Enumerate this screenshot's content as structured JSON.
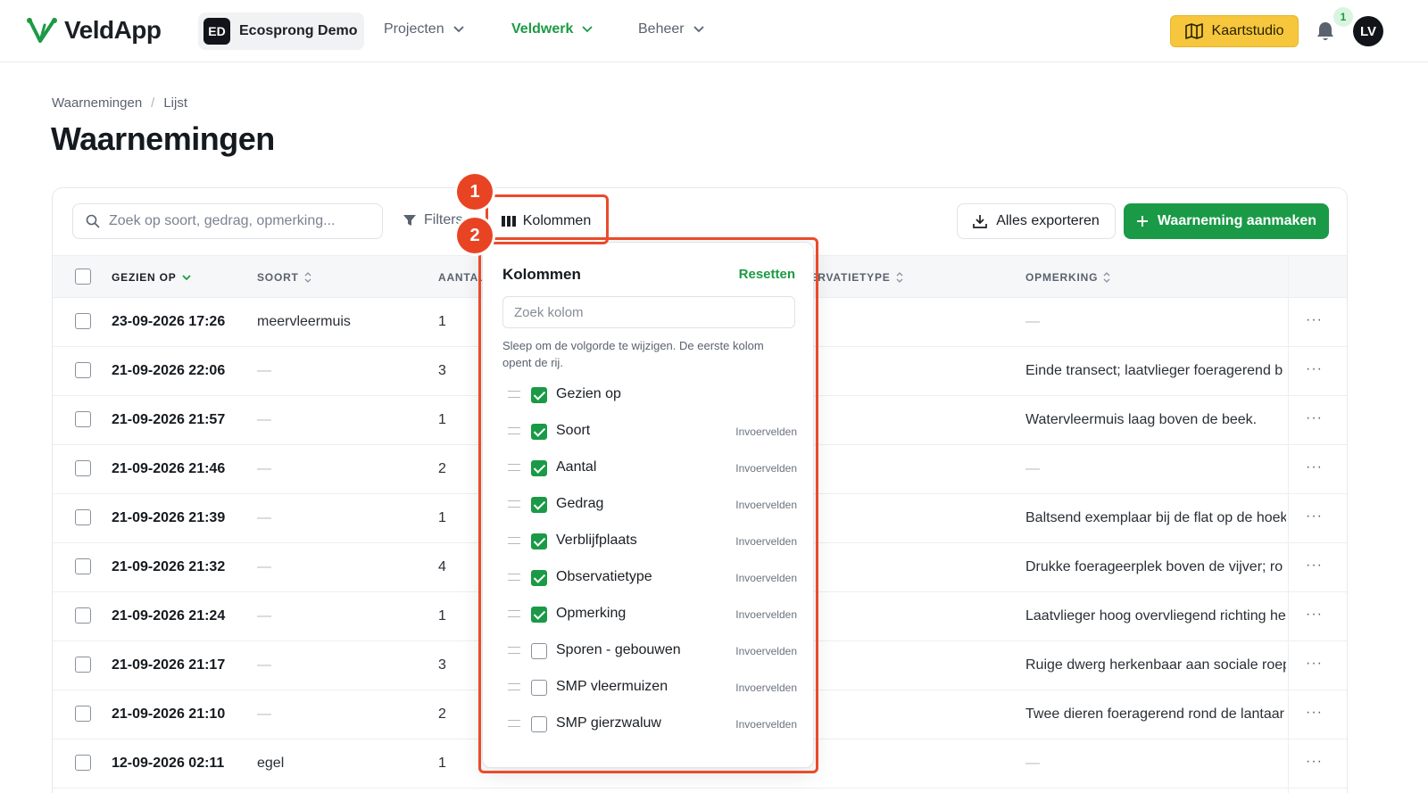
{
  "app": {
    "name": "VeldApp"
  },
  "workspace": {
    "initials": "ED",
    "name": "Ecosprong Demo"
  },
  "nav": [
    {
      "label": "Projecten",
      "active": false
    },
    {
      "label": "Veldwerk",
      "active": true
    },
    {
      "label": "Beheer",
      "active": false
    }
  ],
  "header": {
    "map_button": "Kaartstudio",
    "notifications": "1",
    "avatar": "LV"
  },
  "breadcrumb": [
    "Waarnemingen",
    "Lijst"
  ],
  "page_title": "Waarnemingen",
  "toolbar": {
    "search_placeholder": "Zoek op soort, gedrag, opmerking...",
    "filters": "Filters",
    "columns": "Kolommen",
    "export": "Alles exporteren",
    "create": "Waarneming aanmaken"
  },
  "table": {
    "headers": {
      "date": "GEZIEN OP",
      "species": "SOORT",
      "count": "AANTAL",
      "obstype": "OBSERVATIETYPE",
      "note": "OPMERKING"
    },
    "rows": [
      {
        "date": "23-09-2026 17:26",
        "species": "meervleermuis",
        "count": "1",
        "note": "—"
      },
      {
        "date": "21-09-2026 22:06",
        "species": "—",
        "count": "3",
        "note": "Einde transect; laatvlieger foeragerend b"
      },
      {
        "date": "21-09-2026 21:57",
        "species": "—",
        "count": "1",
        "note": "Watervleermuis laag boven de beek."
      },
      {
        "date": "21-09-2026 21:46",
        "species": "—",
        "count": "2",
        "note": "—"
      },
      {
        "date": "21-09-2026 21:39",
        "species": "—",
        "count": "1",
        "note": "Baltsend exemplaar bij de flat op de hoek"
      },
      {
        "date": "21-09-2026 21:32",
        "species": "—",
        "count": "4",
        "note": "Drukke foerageerplek boven de vijver; ro"
      },
      {
        "date": "21-09-2026 21:24",
        "species": "—",
        "count": "1",
        "note": "Laatvlieger hoog overvliegend richting he"
      },
      {
        "date": "21-09-2026 21:17",
        "species": "—",
        "count": "3",
        "note": "Ruige dwerg herkenbaar aan sociale roep"
      },
      {
        "date": "21-09-2026 21:10",
        "species": "—",
        "count": "2",
        "note": "Twee dieren foeragerend rond de lantaar"
      },
      {
        "date": "12-09-2026 02:11",
        "species": "egel",
        "count": "1",
        "note": "—"
      }
    ]
  },
  "columns_panel": {
    "title": "Kolommen",
    "reset": "Resetten",
    "search_placeholder": "Zoek kolom",
    "hint": "Sleep om de volgorde te wijzigen. De eerste kolom opent de rij.",
    "items": [
      {
        "label": "Gezien op",
        "checked": true,
        "group": ""
      },
      {
        "label": "Soort",
        "checked": true,
        "group": "Invoervelden"
      },
      {
        "label": "Aantal",
        "checked": true,
        "group": "Invoervelden"
      },
      {
        "label": "Gedrag",
        "checked": true,
        "group": "Invoervelden"
      },
      {
        "label": "Verblijfplaats",
        "checked": true,
        "group": "Invoervelden"
      },
      {
        "label": "Observatietype",
        "checked": true,
        "group": "Invoervelden"
      },
      {
        "label": "Opmerking",
        "checked": true,
        "group": "Invoervelden"
      },
      {
        "label": "Sporen - gebouwen",
        "checked": false,
        "group": "Invoervelden"
      },
      {
        "label": "SMP vleermuizen",
        "checked": false,
        "group": "Invoervelden"
      },
      {
        "label": "SMP gierzwaluw",
        "checked": false,
        "group": "Invoervelden"
      }
    ]
  },
  "annotations": [
    "1",
    "2"
  ],
  "colors": {
    "brand_green": "#1a9a46",
    "accent_yellow": "#f6c63d",
    "annotation": "#ea4b2b"
  }
}
